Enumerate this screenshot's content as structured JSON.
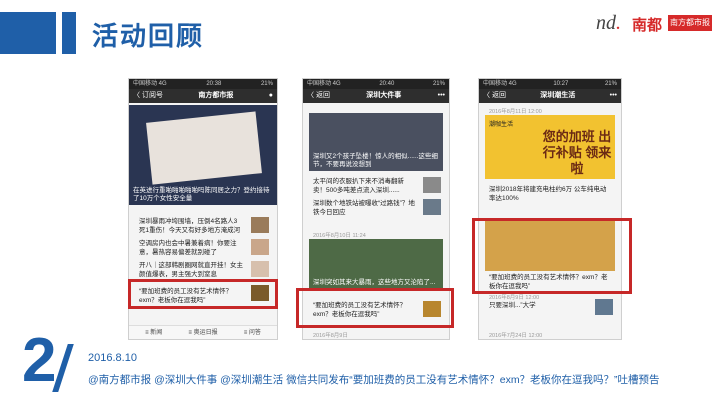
{
  "slide": {
    "title": "活动回顾",
    "number": "2",
    "date": "2016.8.10",
    "caption": "@南方都市报 @深圳大件事 @深圳潮生活 微信共同发布“要加班费的员工没有艺术情怀？exm？老板你在逗我吗？”吐槽预告"
  },
  "brand": {
    "nd": "nd",
    "dot": ".",
    "name": "南都",
    "box": "南方都市报"
  },
  "colors": {
    "accent": "#1f5fa8",
    "highlight": "#c62828"
  },
  "phones": [
    {
      "status_left": "中国移动 4G",
      "status_time": "20:38",
      "status_right": "21%",
      "nav_back": "〈 订阅号",
      "nav_title": "南方都市报",
      "nav_right": "●",
      "img_caption": "在英进行重啪啪啪啪啪吗陈同居之力？登约接待了10万个女性安全量",
      "items": [
        "深圳暴雨冲垮围墙，压倒4名路人3死1重伤！今天又有好多地方淹成河",
        "空调房内也会中暑兼着病！你要注意，暑热容易偏差就别碰了",
        "开八｜这部韩剧圈网就直开挂！女主颜值爆表，男主强大到窒息"
      ],
      "highlight": "“要加班费的员工没有艺术情怀？exm？老板你在逗我吗”",
      "tabs": [
        "≡ 新闻",
        "≡ 奥运日报",
        "≡ 问答"
      ]
    },
    {
      "status_left": "中国移动 4G",
      "status_time": "20:40",
      "status_right": "21%",
      "nav_back": "〈 返回",
      "nav_title": "深圳大件事",
      "nav_right": "•••",
      "img_caption": "深圳又2个孩子坠楼！惊人的相似......这些细节，不要再说没想到",
      "items": [
        "太平间的衣服扒下来不消毒翻新卖！500多吨差点流入深圳......",
        "深圳数个地铁站被曝收“过路钱”？地铁今日回应"
      ],
      "date2": "2016年8月10日 11:24",
      "img2_caption": "深圳突如其来大暴雨，这些地方又沦陷了...",
      "highlight": "“要加班费的员工没有艺术情怀？exm？老板你在逗我吗”",
      "date3": "2016年8月9日"
    },
    {
      "status_left": "中国移动 4G",
      "status_time": "10:27",
      "status_right": "21%",
      "nav_back": "〈 返回",
      "nav_title": "深圳潮生活",
      "nav_right": "•••",
      "date1": "2016年8月11日 12:00",
      "banner_text": "您的加班 出行补贴 领来啦",
      "banner_tag": "潮咖生活",
      "item1_title": "深圳2018年将建充电柱约6万 公车纯电动率达100%",
      "highlight": "“要加班费的员工没有艺术情怀？exm？老板你在逗我吗”",
      "date2": "2016年8月9日 12:00",
      "item2_title": "只要深圳...”大学",
      "date3": "2016年7月24日 12:00"
    }
  ]
}
